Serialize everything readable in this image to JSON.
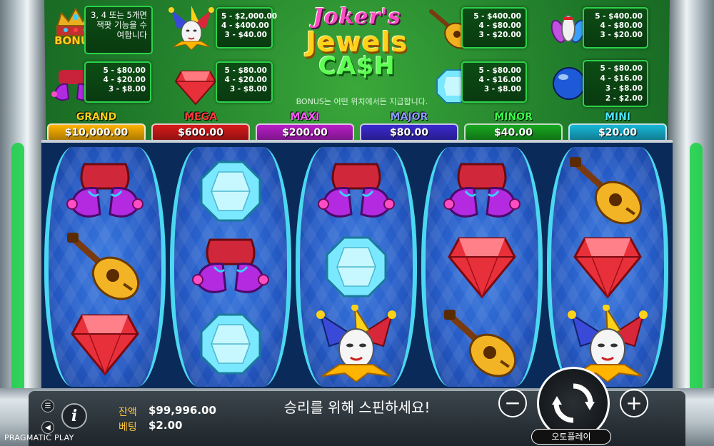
{
  "logo": {
    "line1": "Joker's",
    "line2": "Jewels",
    "line3": "CA$H"
  },
  "paytable": {
    "bonus_label": "BONUS",
    "bonus_text": "3, 4 또는 5개면 잭팟 기능을 수여합니다",
    "bonus_note": "BONUS는 어떤 위치에서든 지급합니다.",
    "jester": [
      "5 - $2,000.00",
      "4 - $400.00",
      "3 - $40.00"
    ],
    "lute": [
      "5 - $400.00",
      "4 - $80.00",
      "3 - $20.00"
    ],
    "bowling": [
      "5 - $400.00",
      "4 - $80.00",
      "3 - $20.00"
    ],
    "shoes": [
      "5 - $80.00",
      "4 - $20.00",
      "3 - $8.00"
    ],
    "ruby": [
      "5 - $80.00",
      "4 - $20.00",
      "3 - $8.00"
    ],
    "diamond": [
      "5 - $80.00",
      "4 - $16.00",
      "3 - $8.00"
    ],
    "orb": [
      "5 - $80.00",
      "4 - $16.00",
      "3 - $8.00",
      "2 - $2.00"
    ]
  },
  "jackpots": [
    {
      "label": "GRAND",
      "value": "$10,000.00",
      "label_color": "#ffd21a",
      "bg": "#ffb400"
    },
    {
      "label": "MEGA",
      "value": "$600.00",
      "label_color": "#ff3b3b",
      "bg": "#d81a1a"
    },
    {
      "label": "MAXI",
      "value": "$200.00",
      "label_color": "#ff5cff",
      "bg": "#b81ec8"
    },
    {
      "label": "MAJOR",
      "value": "$80.00",
      "label_color": "#8a9bff",
      "bg": "#3a2ad0"
    },
    {
      "label": "MINOR",
      "value": "$40.00",
      "label_color": "#3dff4a",
      "bg": "#18a820"
    },
    {
      "label": "MINI",
      "value": "$20.00",
      "label_color": "#4ae8ff",
      "bg": "#18b8d8"
    }
  ],
  "reels": [
    [
      "shoes",
      "lute",
      "ruby"
    ],
    [
      "diamond",
      "shoes",
      "diamond"
    ],
    [
      "shoes",
      "diamond",
      "jester"
    ],
    [
      "shoes",
      "ruby",
      "lute"
    ],
    [
      "lute",
      "ruby",
      "jester"
    ]
  ],
  "footer": {
    "message": "승리를 위해 스핀하세요!",
    "balance_label": "잔액",
    "balance_value": "$99,996.00",
    "bet_label": "베팅",
    "bet_value": "$2.00",
    "brand": "PRAGMATIC PLAY",
    "autoplay_label": "오토플레이",
    "minus": "−",
    "plus": "+",
    "info": "i"
  }
}
